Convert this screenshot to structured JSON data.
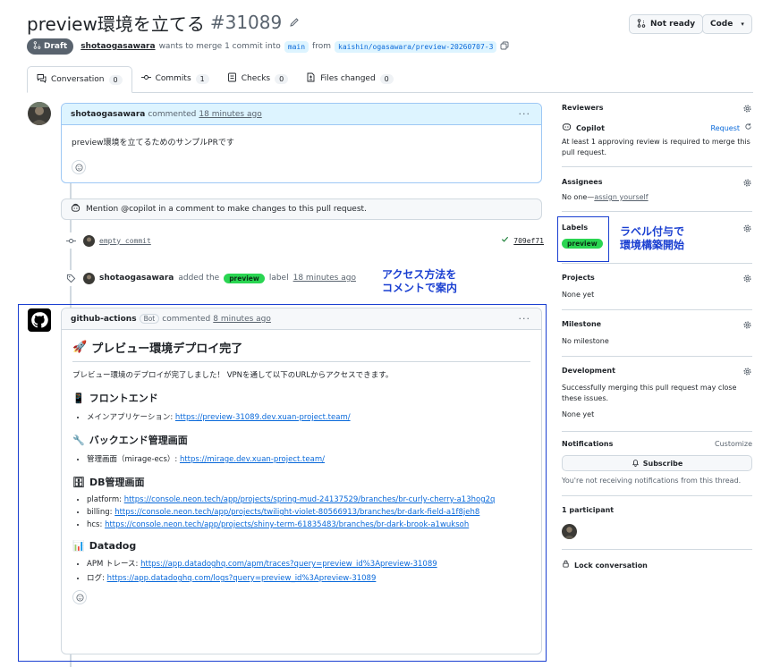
{
  "pr": {
    "title": "preview環境を立てる",
    "number": "#31089",
    "status": "Draft",
    "author": "shotaogasawara",
    "merge_text": "wants to merge 1 commit into",
    "base_branch": "main",
    "from_text": "from",
    "head_branch": "kaishin/ogasawara/preview-20260707-3"
  },
  "header_buttons": {
    "not_ready": "Not ready",
    "code": "Code"
  },
  "tabs": [
    {
      "label": "Conversation",
      "count": "0"
    },
    {
      "label": "Commits",
      "count": "1"
    },
    {
      "label": "Checks",
      "count": "0"
    },
    {
      "label": "Files changed",
      "count": "0"
    }
  ],
  "timeline": {
    "comment1": {
      "author": "shotaogasawara",
      "action": "commented",
      "time": "18 minutes ago",
      "body": "preview環境を立てるためのサンプルPRです"
    },
    "copilot_notice": "Mention @copilot in a comment to make changes to this pull request.",
    "commit": {
      "message": "empty commit",
      "sha": "709ef71"
    },
    "label_event": {
      "author": "shotaogasawara",
      "action": "added the",
      "label": "preview",
      "suffix": "label",
      "time": "18 minutes ago"
    },
    "comment2": {
      "author": "github-actions",
      "badge": "Bot",
      "action": "commented",
      "time": "8 minutes ago",
      "heading_icon": "🚀",
      "heading": "プレビュー環境デプロイ完了",
      "intro": "プレビュー環境のデプロイが完了しました！ VPNを通して以下のURLからアクセスできます。",
      "sections": [
        {
          "icon": "📱",
          "title": "フロントエンド",
          "items": [
            {
              "key": "メインアプリケーション: ",
              "url": "https://preview-31089.dev.xuan-project.team/"
            }
          ]
        },
        {
          "icon": "🔧",
          "title": "バックエンド管理画面",
          "items": [
            {
              "key": "管理画面（mirage-ecs）: ",
              "url": "https://mirage.dev.xuan-project.team/"
            }
          ]
        },
        {
          "icon": "🗄",
          "title": "DB管理画面",
          "items": [
            {
              "key": "platform: ",
              "url": "https://console.neon.tech/app/projects/spring-mud-24137529/branches/br-curly-cherry-a13hog2q"
            },
            {
              "key": "billing: ",
              "url": "https://console.neon.tech/app/projects/twilight-violet-80566913/branches/br-dark-field-a1f8jeh8"
            },
            {
              "key": "hcs: ",
              "url": "https://console.neon.tech/app/projects/shiny-term-61835483/branches/br-dark-brook-a1wuksoh"
            }
          ]
        },
        {
          "icon": "📊",
          "title": "Datadog",
          "items": [
            {
              "key": "APM トレース: ",
              "url": "https://app.datadoghq.com/apm/traces?query=preview_id%3Apreview-31089"
            },
            {
              "key": "ログ: ",
              "url": "https://app.datadoghq.com/logs?query=preview_id%3Apreview-31089"
            }
          ]
        }
      ]
    }
  },
  "sidebar": {
    "reviewers": {
      "title": "Reviewers",
      "name": "Copilot",
      "request": "Request",
      "note": "At least 1 approving review is required to merge this pull request."
    },
    "assignees": {
      "title": "Assignees",
      "none": "No one—",
      "assign_link": "assign yourself"
    },
    "labels": {
      "title": "Labels",
      "label": "preview"
    },
    "projects": {
      "title": "Projects",
      "value": "None yet"
    },
    "milestone": {
      "title": "Milestone",
      "value": "No milestone"
    },
    "development": {
      "title": "Development",
      "note": "Successfully merging this pull request may close these issues.",
      "value": "None yet"
    },
    "notifications": {
      "title": "Notifications",
      "customize": "Customize",
      "subscribe": "Subscribe",
      "note": "You're not receiving notifications from this thread."
    },
    "participants": {
      "title": "1 participant"
    },
    "lock": "Lock conversation"
  },
  "annotations": {
    "labels_note": [
      "ラベル付与で",
      "環境構築開始"
    ],
    "access_note": [
      "アクセス方法を",
      "コメントで案内"
    ]
  },
  "colors": {
    "accent_link": "#0969da",
    "label_green": "#2ad552",
    "annotation_blue": "#1a3fd1"
  }
}
